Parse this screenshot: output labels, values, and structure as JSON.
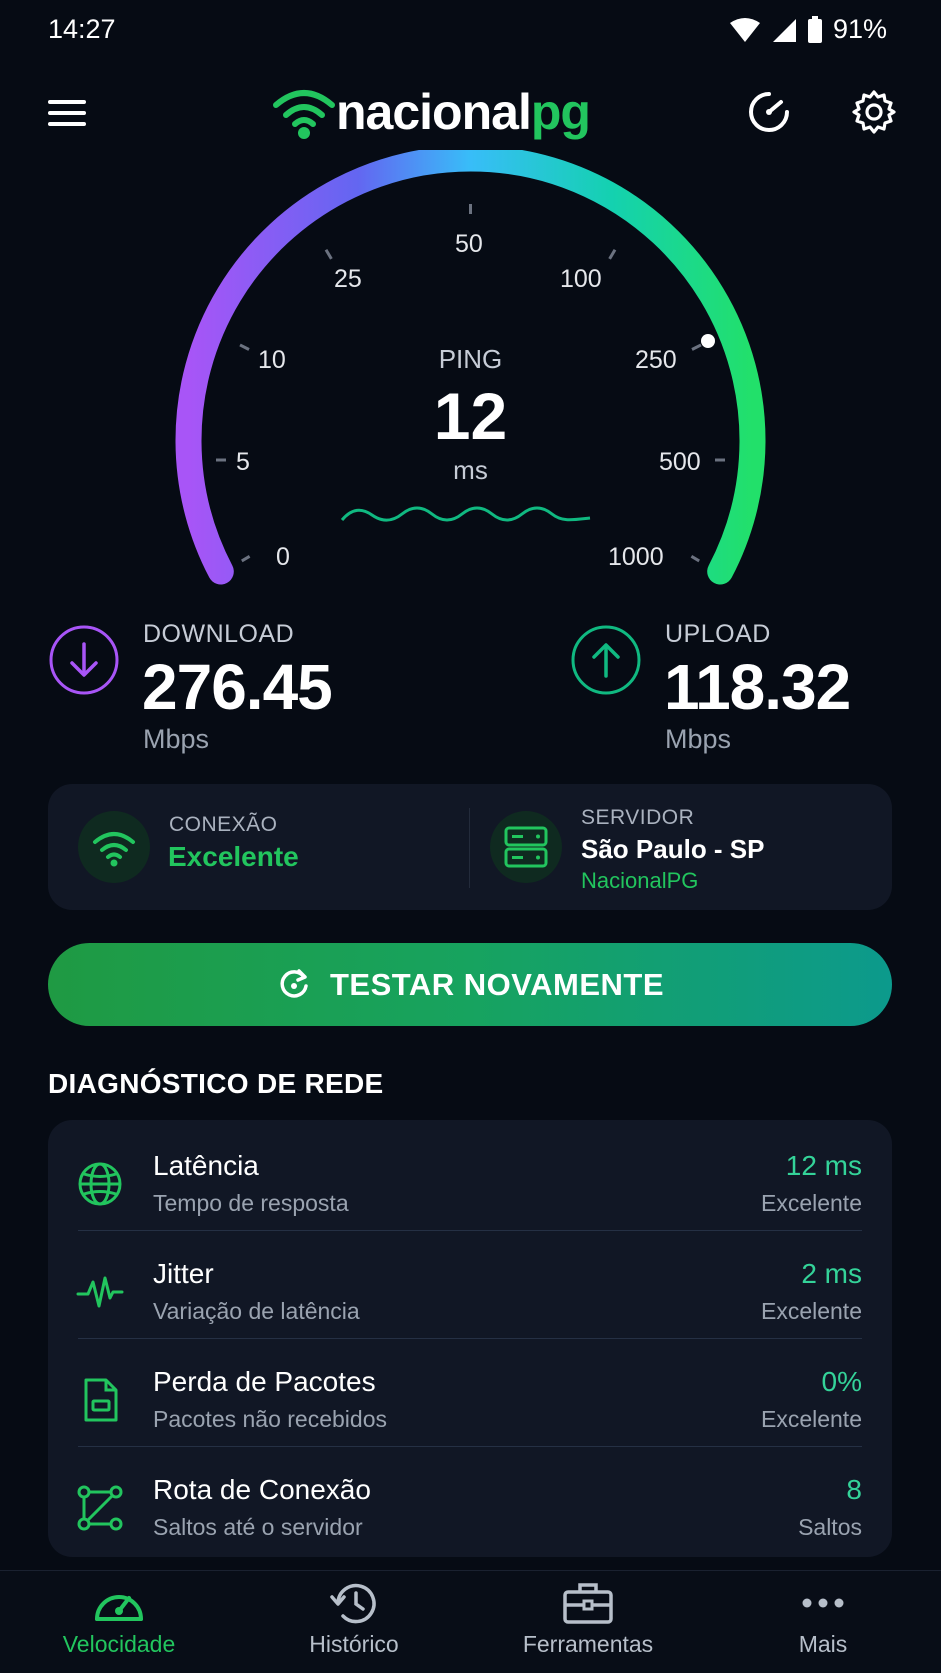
{
  "status_bar": {
    "time": "14:27",
    "battery": "91%"
  },
  "header": {
    "logo_main": "nacional",
    "logo_accent": "pg",
    "menu_icon": "hamburger-menu-icon",
    "history_icon": "speedometer-history-icon",
    "settings_icon": "gear-icon"
  },
  "gauge": {
    "ticks": [
      "0",
      "5",
      "10",
      "25",
      "50",
      "100",
      "250",
      "500",
      "1000"
    ],
    "label": "PING",
    "value": "12",
    "unit": "ms",
    "gradient_colors": [
      "#8b5cf6",
      "#38bdf8",
      "#22d3a5",
      "#22c55e"
    ]
  },
  "download": {
    "label": "DOWNLOAD",
    "value": "276.45",
    "unit": "Mbps",
    "color": "#a855f7"
  },
  "upload": {
    "label": "UPLOAD",
    "value": "118.32",
    "unit": "Mbps",
    "color": "#10b981"
  },
  "connection": {
    "label": "CONEXÃO",
    "value": "Excelente"
  },
  "server": {
    "label": "SERVIDOR",
    "location": "São Paulo - SP",
    "provider": "NacionalPG"
  },
  "retest": {
    "label": "TESTAR NOVAMENTE"
  },
  "diagnostics": {
    "title": "DIAGNÓSTICO DE REDE",
    "rows": [
      {
        "icon": "globe-icon",
        "title": "Latência",
        "subtitle": "Tempo de resposta",
        "value": "12 ms",
        "status": "Excelente"
      },
      {
        "icon": "pulse-icon",
        "title": "Jitter",
        "subtitle": "Variação de latência",
        "value": "2 ms",
        "status": "Excelente"
      },
      {
        "icon": "packet-icon",
        "title": "Perda de Pacotes",
        "subtitle": "Pacotes não recebidos",
        "value": "0%",
        "status": "Excelente"
      },
      {
        "icon": "route-icon",
        "title": "Rota de Conexão",
        "subtitle": "Saltos até o servidor",
        "value": "8",
        "status": "Saltos"
      }
    ]
  },
  "nav": {
    "items": [
      {
        "label": "Velocidade",
        "icon": "speedometer-icon",
        "active": true
      },
      {
        "label": "Histórico",
        "icon": "history-icon",
        "active": false
      },
      {
        "label": "Ferramentas",
        "icon": "toolbox-icon",
        "active": false
      },
      {
        "label": "Mais",
        "icon": "more-dots-icon",
        "active": false
      }
    ]
  },
  "colors": {
    "accent": "#22c55e",
    "background": "#060b14",
    "card": "#111725"
  }
}
